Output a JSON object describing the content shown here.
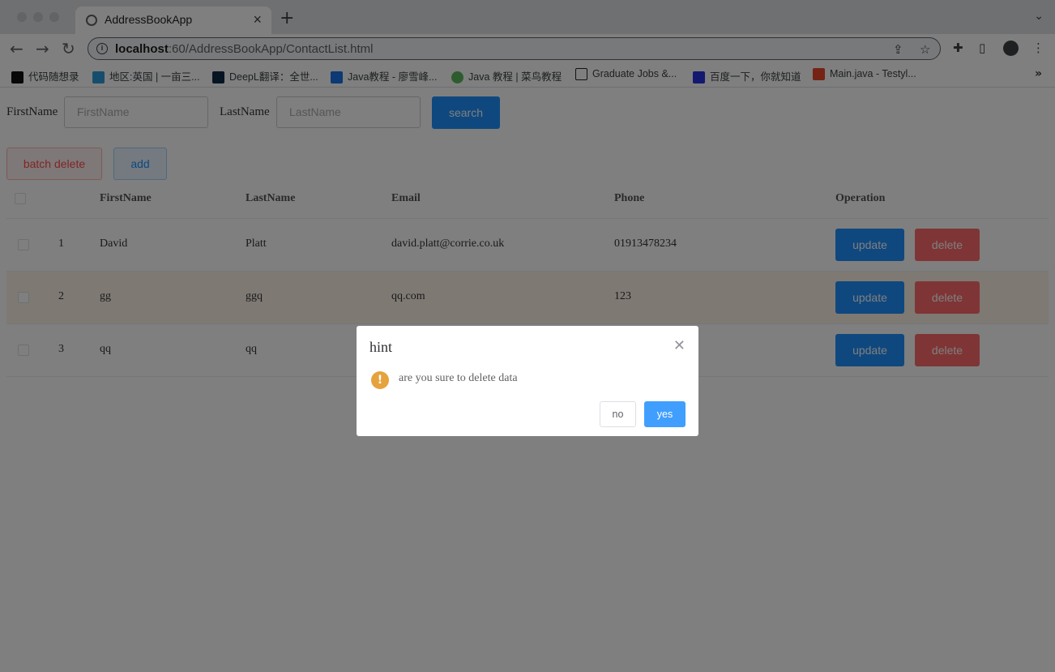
{
  "browser": {
    "tab_title": "AddressBookApp",
    "url_host": "localhost",
    "url_rest": ":60/AddressBookApp/ContactList.html",
    "bookmarks": [
      "代码随想录",
      "地区:英国 | 一亩三...",
      "DeepL翻译：全世...",
      "Java教程 - 廖雪峰...",
      "Java 教程 | 菜鸟教程",
      "Graduate Jobs &...",
      "百度一下，你就知道",
      "Main.java - Testyl..."
    ]
  },
  "search": {
    "firstname_label": "FirstName",
    "firstname_placeholder": "FirstName",
    "lastname_label": "LastName",
    "lastname_placeholder": "LastName",
    "search_label": "search"
  },
  "actions": {
    "batch_delete_label": "batch delete",
    "add_label": "add"
  },
  "table": {
    "headers": [
      "FirstName",
      "LastName",
      "Email",
      "Phone",
      "Operation"
    ],
    "rows": [
      {
        "index": "1",
        "firstname": "David",
        "lastname": "Platt",
        "email": "david.platt@corrie.co.uk",
        "phone": "01913478234"
      },
      {
        "index": "2",
        "firstname": "gg",
        "lastname": "ggq",
        "email": "qq.com",
        "phone": "123"
      },
      {
        "index": "3",
        "firstname": "qq",
        "lastname": "qq",
        "email": "",
        "phone": ""
      }
    ],
    "update_label": "update",
    "delete_label": "delete"
  },
  "dialog": {
    "title": "hint",
    "message": "are you sure to delete data",
    "no_label": "no",
    "yes_label": "yes"
  },
  "colors": {
    "primary": "#1e90ff",
    "danger": "#ff6b6b",
    "warning": "#e6a23c",
    "dialog_primary": "#409eff"
  }
}
